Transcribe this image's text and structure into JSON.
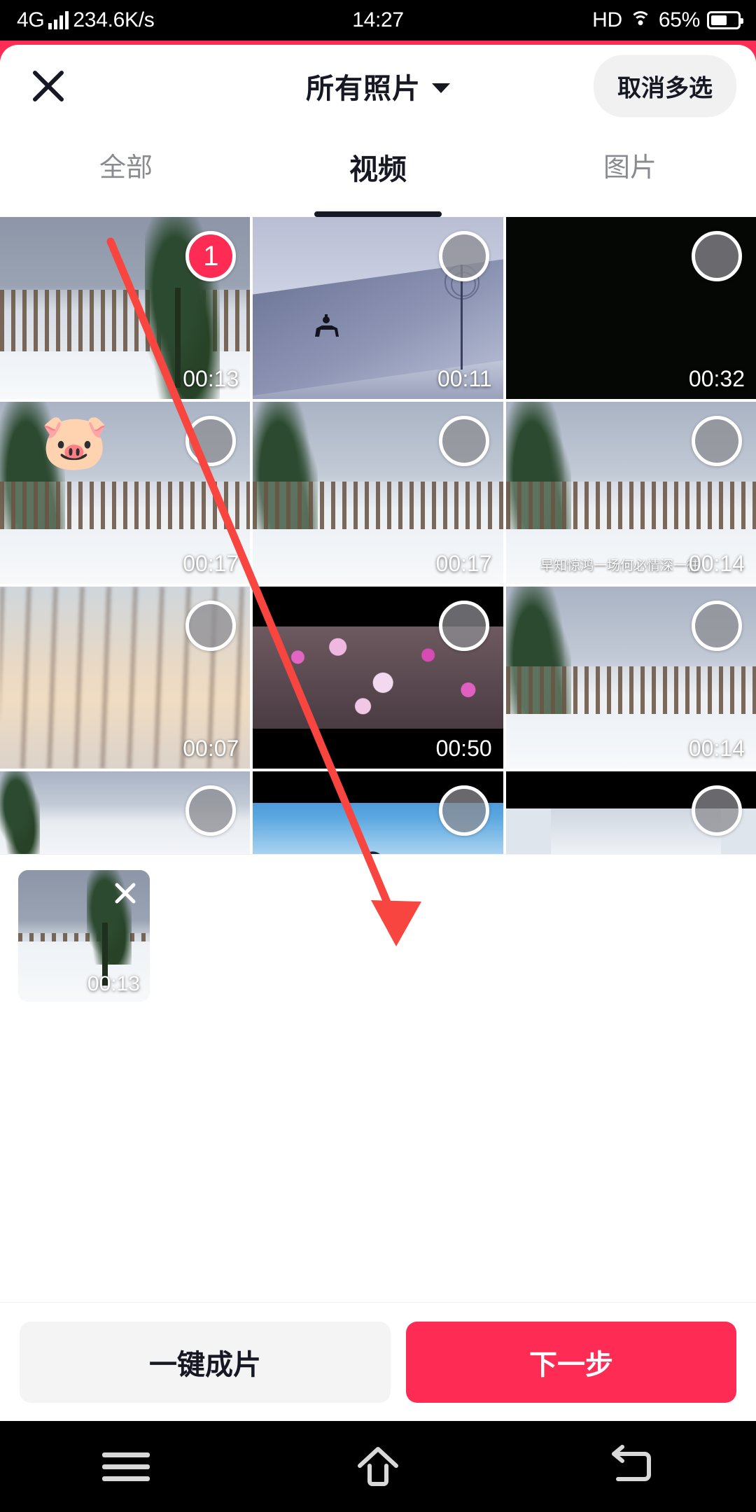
{
  "status_bar": {
    "network_type": "4G",
    "signal_icon": "signal-bars-icon",
    "data_rate": "234.6K/s",
    "time": "14:27",
    "hd_label": "HD",
    "wifi_icon": "wifi-icon",
    "battery_percent": "65%",
    "battery_icon": "battery-icon"
  },
  "header": {
    "close_icon": "close-icon",
    "title": "所有照片",
    "chevron_icon": "chevron-down-icon",
    "cancel_multiselect_label": "取消多选"
  },
  "tabs": [
    {
      "label": "全部",
      "active": false
    },
    {
      "label": "视频",
      "active": true
    },
    {
      "label": "图片",
      "active": false
    }
  ],
  "grid": {
    "rows": [
      [
        {
          "duration": "00:13",
          "selected": true,
          "badge": "1",
          "scene": "snow-fence",
          "sticker": ""
        },
        {
          "duration": "00:11",
          "selected": false,
          "badge": "",
          "scene": "horse-field",
          "sticker": ""
        },
        {
          "duration": "00:32",
          "selected": false,
          "badge": "",
          "scene": "black",
          "sticker": ""
        }
      ],
      [
        {
          "duration": "00:17",
          "selected": false,
          "badge": "",
          "scene": "snow-deck",
          "sticker": "🐷"
        },
        {
          "duration": "00:17",
          "selected": false,
          "badge": "",
          "scene": "snow-deck",
          "sticker": ""
        },
        {
          "duration": "00:14",
          "selected": false,
          "badge": "",
          "scene": "snow-deck",
          "sticker": "",
          "watermark": "早知惊鸿一场何必情深一往"
        }
      ],
      [
        {
          "duration": "00:07",
          "selected": false,
          "badge": "",
          "scene": "sunset-lake",
          "sticker": ""
        },
        {
          "duration": "00:50",
          "selected": false,
          "badge": "",
          "scene": "blossom",
          "sticker": ""
        },
        {
          "duration": "00:14",
          "selected": false,
          "badge": "",
          "scene": "snow-deck",
          "sticker": ""
        }
      ],
      [
        {
          "duration": "",
          "selected": false,
          "badge": "",
          "scene": "snow-sky",
          "sticker": ""
        },
        {
          "duration": "",
          "selected": false,
          "badge": "",
          "scene": "birds-sky",
          "sticker": ""
        },
        {
          "duration": "",
          "selected": false,
          "badge": "",
          "scene": "snow-fence-letterbox",
          "sticker": ""
        }
      ]
    ]
  },
  "selected_tray": [
    {
      "duration": "00:13",
      "remove_icon": "close-icon"
    }
  ],
  "action_bar": {
    "secondary_label": "一键成片",
    "primary_label": "下一步"
  },
  "nav_bar": {
    "menu_icon": "menu-icon",
    "home_icon": "home-icon",
    "back_icon": "back-icon"
  },
  "annotation": {
    "arrow_icon": "red-arrow-annotation",
    "color": "#F8453F"
  },
  "colors": {
    "accent": "#FE2C55",
    "text_primary": "#161823",
    "text_muted": "#8A8B91",
    "chip_bg": "#F1F1F2"
  }
}
